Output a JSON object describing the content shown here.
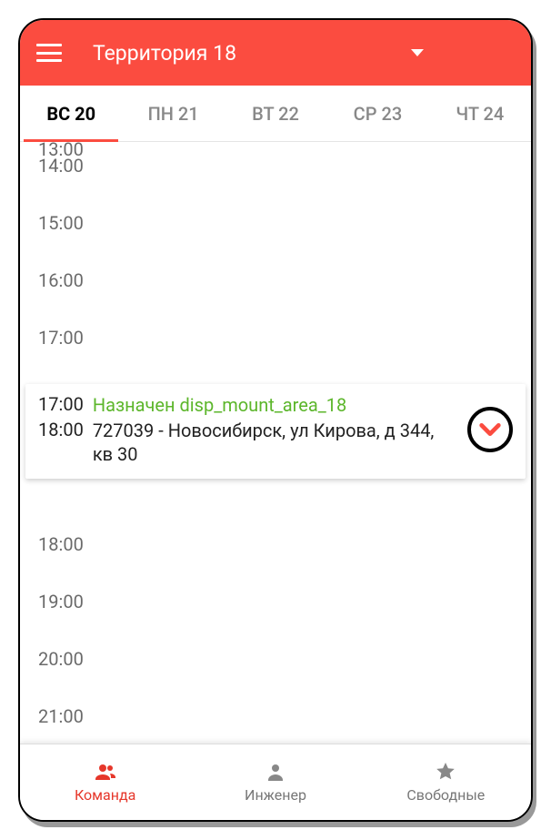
{
  "header": {
    "title": "Территория 18"
  },
  "tabs": {
    "t0": "ВС 20",
    "t1": "ПН 21",
    "t2": "ВТ 22",
    "t3": "СР 23",
    "t4": "ЧТ 24"
  },
  "times": {
    "t13": "13:00",
    "t14": "14:00",
    "t15": "15:00",
    "t16": "16:00",
    "t17": "17:00",
    "t18": "18:00",
    "t19": "19:00",
    "t20": "20:00",
    "t21": "21:00"
  },
  "event": {
    "start": "17:00",
    "end": "18:00",
    "assigned": "Назначен disp_mount_area_18",
    "address": "727039 - Новосибирск, ул Кирова, д 344, кв 30"
  },
  "bottomNav": {
    "team": "Команда",
    "engineer": "Инженер",
    "free": "Свободные"
  }
}
